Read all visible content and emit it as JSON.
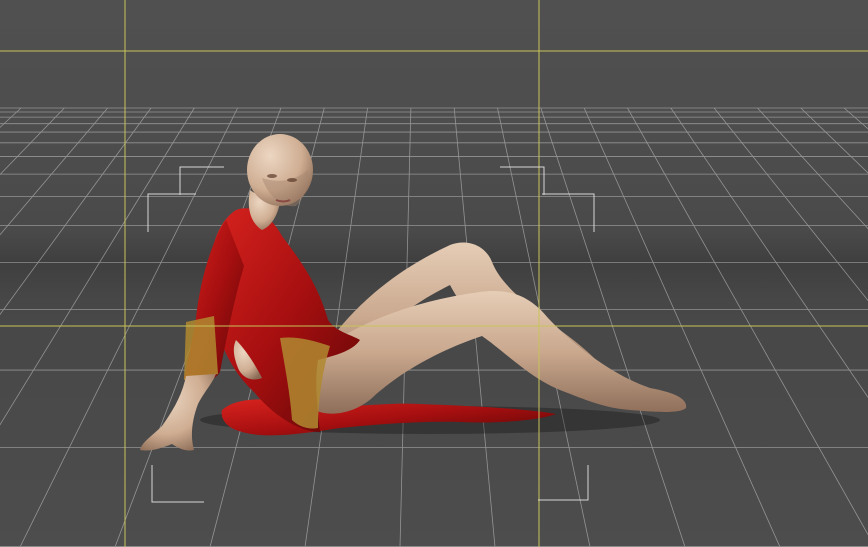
{
  "viewport": {
    "background": "#4b4b4b",
    "grid_color": "#c8c8c8",
    "guide_color": "#c8c35a",
    "figure": {
      "skin_color": "#d2b49a",
      "dress_color": "#b81414",
      "trim_color": "#b8922e"
    }
  }
}
